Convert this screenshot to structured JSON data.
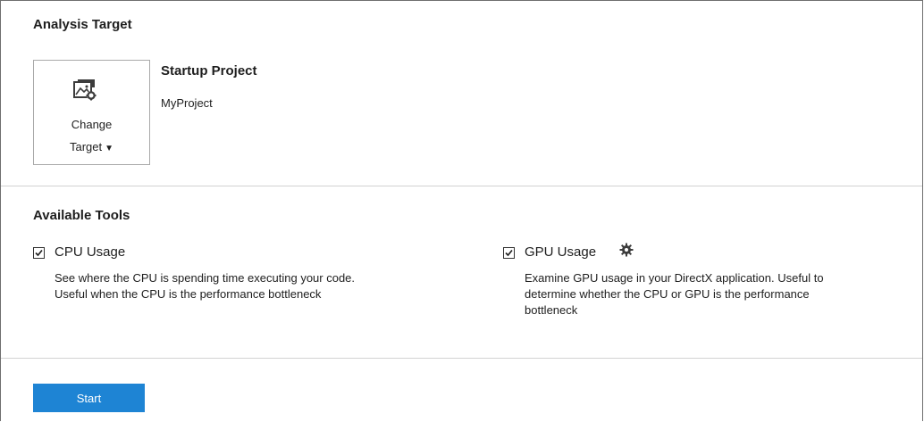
{
  "analysis_target": {
    "title": "Analysis Target",
    "change_target": {
      "line1": "Change",
      "line2": "Target"
    },
    "startup_project_label": "Startup Project",
    "project_name": "MyProject"
  },
  "available_tools": {
    "title": "Available Tools",
    "tools": [
      {
        "name": "CPU Usage",
        "checked": true,
        "description_lines": [
          "See where the CPU is spending time executing your code.",
          "Useful when the CPU is the performance bottleneck"
        ],
        "icon": "check-icon"
      },
      {
        "name": "GPU Usage",
        "checked": true,
        "settings_icon": "gear-icon",
        "description_lines": [
          "Examine GPU usage in your DirectX application. Useful to",
          "determine whether the CPU or GPU is the performance",
          "bottleneck"
        ],
        "icon": "check-icon"
      }
    ]
  },
  "actions": {
    "start_label": "Start"
  },
  "colors": {
    "accent": "#1e84d4",
    "divider": "#d2d2d2",
    "text": "#1e1e1e"
  }
}
